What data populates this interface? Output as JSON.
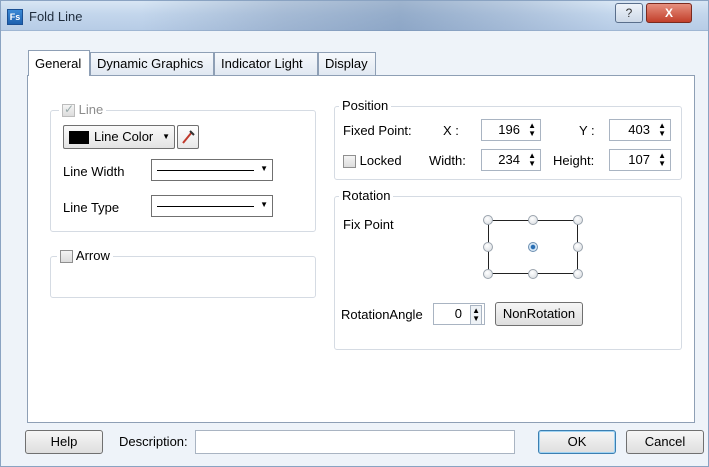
{
  "window": {
    "title": "Fold Line",
    "app_icon_text": "Fs",
    "help_glyph": "?",
    "close_glyph": "X"
  },
  "tabs": [
    {
      "label": "General",
      "active": true
    },
    {
      "label": "Dynamic Graphics",
      "active": false
    },
    {
      "label": "Indicator Light",
      "active": false
    },
    {
      "label": "Display",
      "active": false
    }
  ],
  "line_group": {
    "legend": "Line",
    "checked": true,
    "enabled": false,
    "color_label": "Line Color",
    "color_value": "#000000",
    "width_label": "Line Width",
    "type_label": "Line Type"
  },
  "arrow_group": {
    "legend": "Arrow",
    "checked": false
  },
  "position": {
    "legend": "Position",
    "fixed_point_label": "Fixed Point:",
    "x_label": "X :",
    "x_value": "196",
    "y_label": "Y :",
    "y_value": "403",
    "locked_label": "Locked",
    "locked_checked": false,
    "width_label": "Width:",
    "width_value": "234",
    "height_label": "Height:",
    "height_value": "107"
  },
  "rotation": {
    "legend": "Rotation",
    "fix_point_label": "Fix Point",
    "selected_point": "center",
    "angle_label": "RotationAngle",
    "angle_value": "0",
    "non_rotation_label": "NonRotation"
  },
  "footer": {
    "help_label": "Help",
    "description_label": "Description:",
    "description_value": "",
    "ok_label": "OK",
    "cancel_label": "Cancel"
  }
}
